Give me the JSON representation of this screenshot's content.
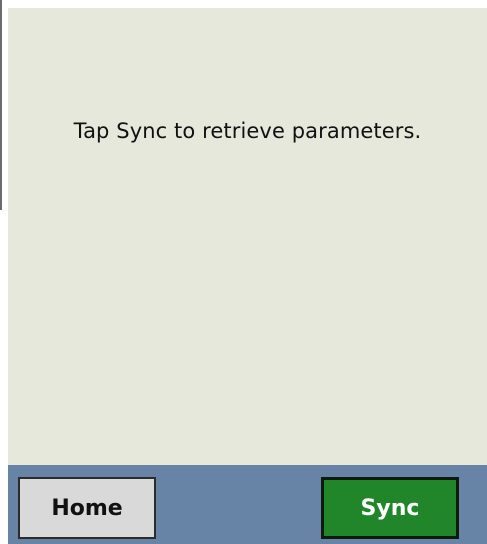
{
  "main": {
    "message": "Tap Sync to retrieve parameters."
  },
  "bottom_bar": {
    "home_label": "Home",
    "sync_label": "Sync"
  },
  "colors": {
    "content_background": "#e7e8dc",
    "bottom_bar_background": "#6784a6",
    "home_button": "#d9d9da",
    "sync_button": "#21862a"
  }
}
